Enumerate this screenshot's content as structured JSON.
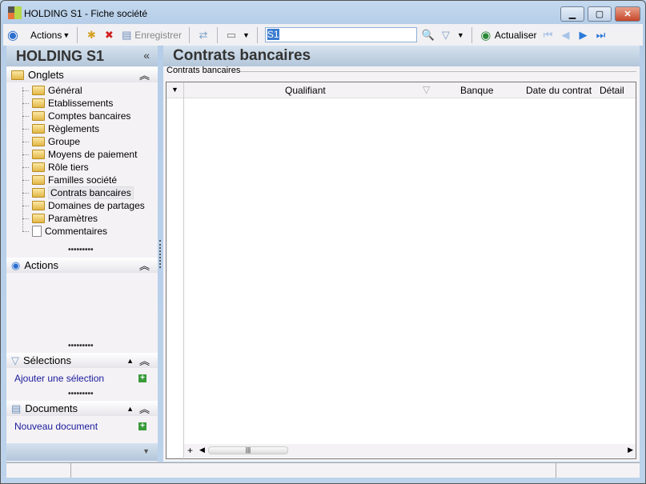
{
  "window": {
    "title": "HOLDING S1 -  Fiche société"
  },
  "toolbar": {
    "actions": "Actions",
    "save": "Enregistrer",
    "search_value": "S1",
    "refresh": "Actualiser"
  },
  "left": {
    "title": "HOLDING S1",
    "collapse": "«",
    "onglets": {
      "label": "Onglets",
      "items": [
        "Général",
        "Etablissements",
        "Comptes bancaires",
        "Règlements",
        "Groupe",
        "Moyens de paiement",
        "Rôle tiers",
        "Familles société",
        "Contrats bancaires",
        "Domaines de partages",
        "Paramètres",
        "Commentaires"
      ],
      "selected": "Contrats bancaires"
    },
    "actions": {
      "label": "Actions"
    },
    "selections": {
      "label": "Sélections",
      "link": "Ajouter une sélection"
    },
    "documents": {
      "label": "Documents",
      "link": "Nouveau document"
    }
  },
  "main": {
    "title": "Contrats bancaires",
    "group_label": "Contrats bancaires",
    "columns": [
      "Qualifiant",
      "Banque",
      "Date du contrat",
      "Détail"
    ]
  }
}
